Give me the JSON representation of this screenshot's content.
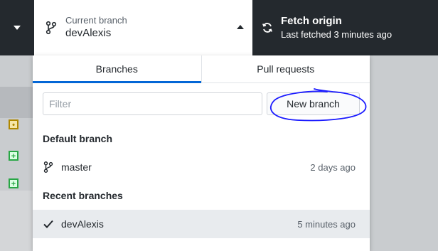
{
  "toolbar": {
    "current_branch_caption": "Current branch",
    "current_branch_name": "devAlexis",
    "fetch_title": "Fetch origin",
    "fetch_subtitle": "Last fetched 3 minutes ago"
  },
  "dropdown": {
    "tabs": [
      {
        "label": "Branches",
        "active": true
      },
      {
        "label": "Pull requests",
        "active": false
      }
    ],
    "filter_placeholder": "Filter",
    "new_branch_label": "New branch",
    "default_section_title": "Default branch",
    "default_branches": [
      {
        "name": "master",
        "time": "2 days ago",
        "icon": "git-branch-icon"
      }
    ],
    "recent_section_title": "Recent branches",
    "recent_branches": [
      {
        "name": "devAlexis",
        "time": "5 minutes ago",
        "icon": "check-icon",
        "selected": true
      }
    ]
  },
  "colors": {
    "toolbar_bg": "#24292e",
    "accent": "#0366d6",
    "annotation": "#1a1aff"
  }
}
